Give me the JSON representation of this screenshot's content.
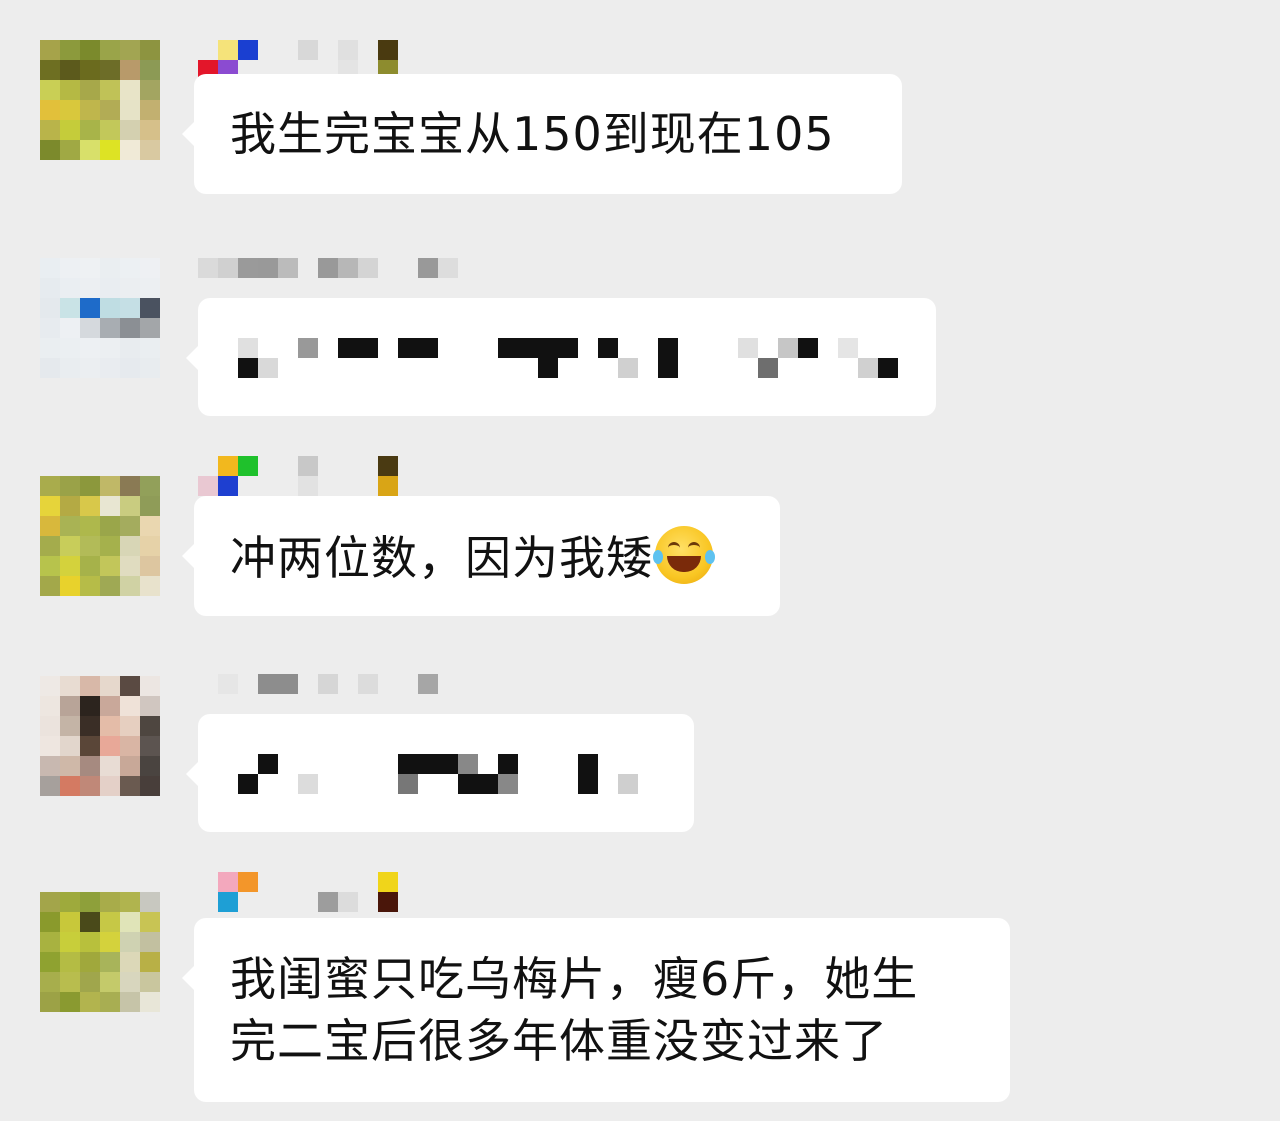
{
  "messages": [
    {
      "text": "我生完宝宝从150到现在105"
    },
    {
      "text": ""
    },
    {
      "text": "冲两位数，因为我矮",
      "emoji": "tears-of-joy-emoji"
    },
    {
      "text": ""
    },
    {
      "line1": "我闺蜜只吃乌梅片，瘦6斤，她生",
      "line2": "完二宝后很多年体重没变过来了"
    }
  ],
  "colors": {
    "background": "#ededed",
    "bubble": "#ffffff",
    "text": "#111111"
  }
}
